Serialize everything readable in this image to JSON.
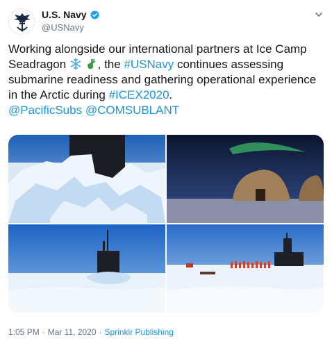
{
  "account": {
    "display_name": "U.S. Navy",
    "handle": "@USNavy",
    "avatar_icon": "navy-eagle-anchor-logo",
    "verified": true
  },
  "tweet": {
    "text_part1": "Working alongside our international partners at Ice Camp Seadragon ",
    "emoji1": "snowflake-emoji",
    "emoji2": "dragon-emoji",
    "text_part2": ", the ",
    "hashtag1": "#USNavy",
    "text_part3": " continues assessing submarine readiness and gathering operational experience in the Arctic during ",
    "hashtag2": "#ICEX2020",
    "text_part4": ".",
    "mention1": "@PacificSubs",
    "mention2": "@COMSUBLANT"
  },
  "media": {
    "photos": [
      {
        "subject": "submarine-sail-through-ice"
      },
      {
        "subject": "arctic-tents-aurora"
      },
      {
        "subject": "submarine-surfaced-on-ice"
      },
      {
        "subject": "crew-standing-near-submarine"
      }
    ]
  },
  "meta": {
    "time": "1:05 PM",
    "separator1": "·",
    "date": "Mar 11, 2020",
    "separator2": "·",
    "source": "Sprinklr Publishing"
  },
  "colors": {
    "link": "#1b95e0",
    "verified": "#1da1f2",
    "secondary_text": "#657786"
  }
}
